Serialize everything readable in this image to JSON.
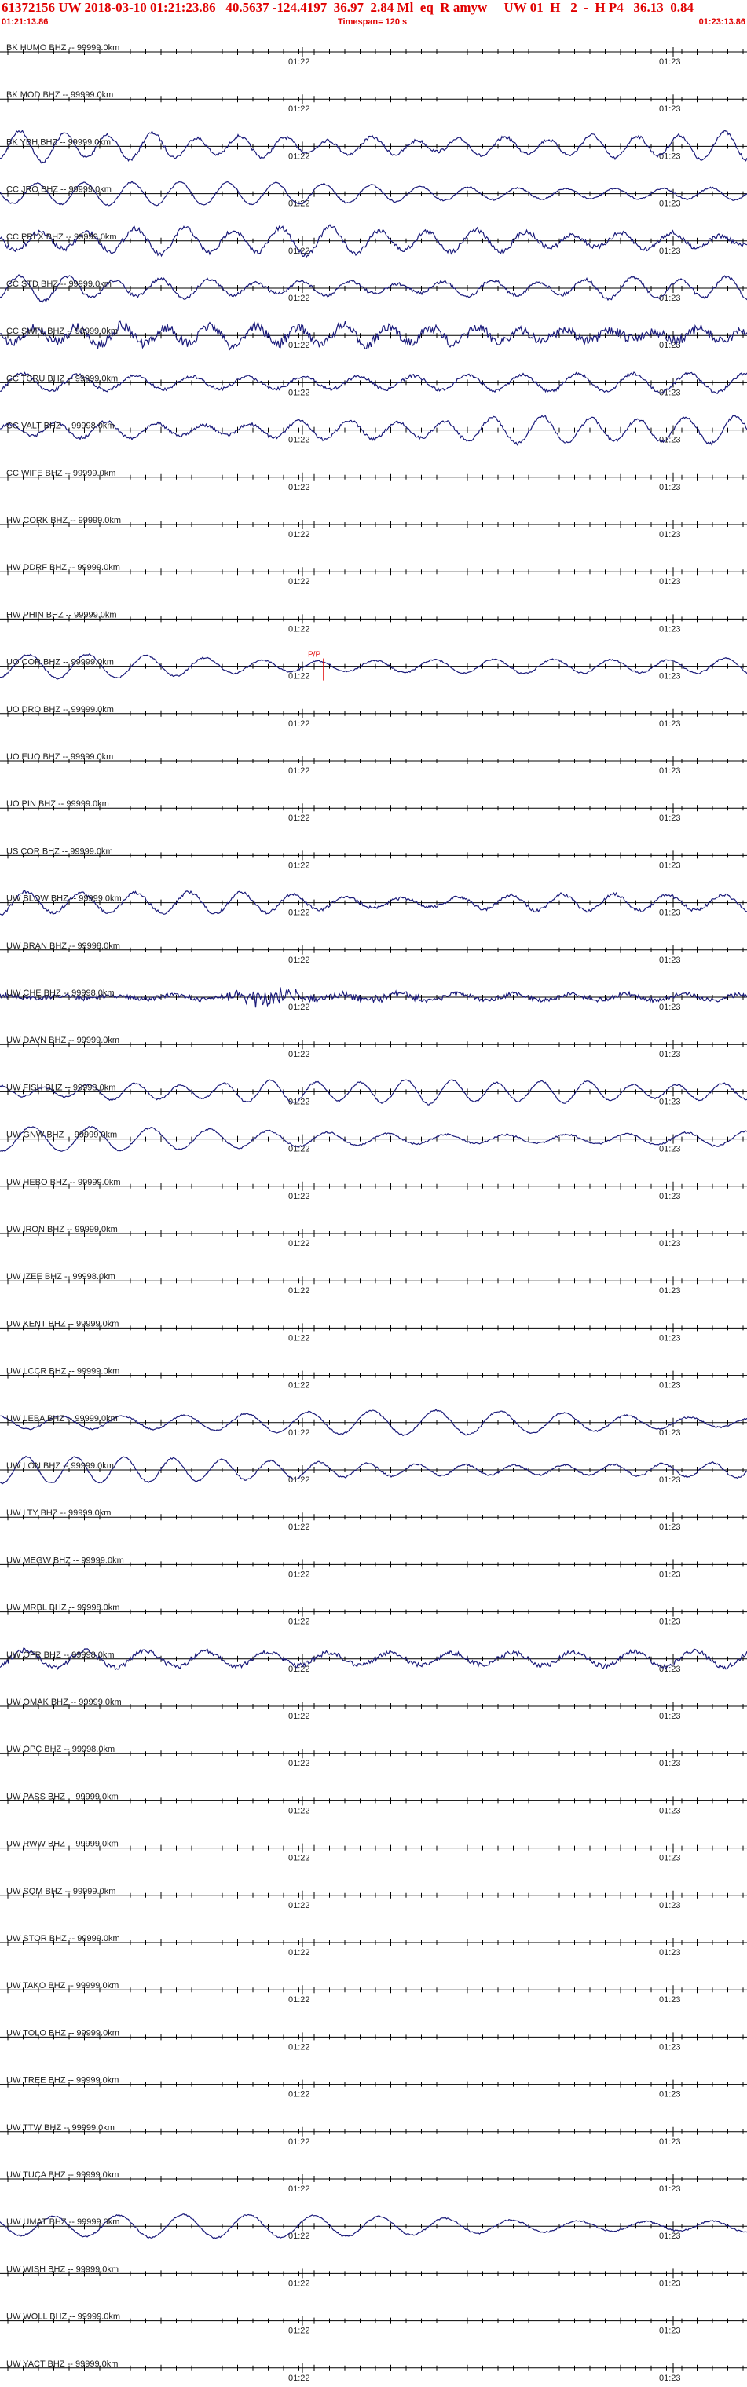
{
  "header": {
    "line1": "61372156 UW 2018-03-10 01:21:23.86   40.5637 -124.4197  36.97  2.84 Ml  eq  R amyw     UW 01  H   2  -  H P4   36.13  0.84",
    "start_time": "01:21:13.86",
    "timespan": "Timespan= 120 s",
    "end_time": "01:23:13.86"
  },
  "time_marks": [
    "01:22",
    "01:23"
  ],
  "pick": {
    "label": "P/P",
    "station": "UO COR BHZ",
    "color": "#e00000"
  },
  "trace_color": "#1a1a7a",
  "channels": [
    {
      "label": "BK HUMO BHZ -- 99999.0km",
      "active": false,
      "amp": 0
    },
    {
      "label": "BK MOD BHZ -- 99999.0km",
      "active": false,
      "amp": 0
    },
    {
      "label": "BK YBH BHZ -- 99999.0km",
      "active": true,
      "amp": 18,
      "noise": 2
    },
    {
      "label": "CC JRO BHZ -- 99999.0km",
      "active": true,
      "amp": 14,
      "noise": 1
    },
    {
      "label": "CC PRLX BHZ -- 99999.0km",
      "active": true,
      "amp": 16,
      "noise": 3
    },
    {
      "label": "CC STD BHZ -- 99999.0km",
      "active": true,
      "amp": 15,
      "noise": 2
    },
    {
      "label": "CC SWFL BHZ -- 99999.0km",
      "active": true,
      "amp": 12,
      "noise": 6
    },
    {
      "label": "CC TCRU BHZ -- 99999.0km",
      "active": true,
      "amp": 14,
      "noise": 2
    },
    {
      "label": "CC VALT BHZ -- 99998.0km",
      "active": true,
      "amp": 16,
      "noise": 2
    },
    {
      "label": "CC WIFE BHZ -- 99999.0km",
      "active": false,
      "amp": 0
    },
    {
      "label": "HW CORK BHZ -- 99999.0km",
      "active": false,
      "amp": 0
    },
    {
      "label": "HW DDRF BHZ -- 99999.0km",
      "active": false,
      "amp": 0
    },
    {
      "label": "HW PHIN BHZ -- 99999.0km",
      "active": false,
      "amp": 0
    },
    {
      "label": "UO COR BHZ -- 99999.0km",
      "active": true,
      "amp": 14,
      "noise": 1
    },
    {
      "label": "UO DRO BHZ -- 99999.0km",
      "active": false,
      "amp": 0
    },
    {
      "label": "UO EUO BHZ -- 99999.0km",
      "active": false,
      "amp": 0
    },
    {
      "label": "UO PIN BHZ -- 99999.0km",
      "active": false,
      "amp": 0
    },
    {
      "label": "US COR BHZ -- 99999.0km",
      "active": false,
      "amp": 0
    },
    {
      "label": "UW BLOW BHZ -- 99999.0km",
      "active": true,
      "amp": 15,
      "noise": 2
    },
    {
      "label": "UW BRAN BHZ -- 99998.0km",
      "active": false,
      "amp": 0
    },
    {
      "label": "UW CHE BHZ -- 99998.0km",
      "active": true,
      "amp": 4,
      "noise": 3,
      "burst": true
    },
    {
      "label": "UW DAVN BHZ -- 99999.0km",
      "active": false,
      "amp": 0
    },
    {
      "label": "UW FISH BHZ -- 99998.0km",
      "active": true,
      "amp": 14,
      "noise": 1
    },
    {
      "label": "UW GNW BHZ -- 99999.0km",
      "active": true,
      "amp": 15,
      "noise": 1
    },
    {
      "label": "UW HEBO BHZ -- 99999.0km",
      "active": false,
      "amp": 0
    },
    {
      "label": "UW IRON BHZ -- 99999.0km",
      "active": false,
      "amp": 0
    },
    {
      "label": "UW IZEE BHZ -- 99998.0km",
      "active": false,
      "amp": 0
    },
    {
      "label": "UW KENT BHZ -- 99999.0km",
      "active": false,
      "amp": 0
    },
    {
      "label": "UW LCCR BHZ -- 99999.0km",
      "active": false,
      "amp": 0
    },
    {
      "label": "UW LEBA BHZ -- 99999.0km",
      "active": true,
      "amp": 14,
      "noise": 1
    },
    {
      "label": "UW LON BHZ -- 99999.0km",
      "active": true,
      "amp": 16,
      "noise": 1
    },
    {
      "label": "UW LTY BHZ -- 99999.0km",
      "active": false,
      "amp": 0
    },
    {
      "label": "UW MEGW BHZ -- 99999.0km",
      "active": false,
      "amp": 0
    },
    {
      "label": "UW MRBL BHZ -- 99998.0km",
      "active": false,
      "amp": 0
    },
    {
      "label": "UW OFR BHZ -- 99998.0km",
      "active": true,
      "amp": 12,
      "noise": 3
    },
    {
      "label": "UW OMAK BHZ -- 99999.0km",
      "active": false,
      "amp": 0
    },
    {
      "label": "UW OPC BHZ -- 99998.0km",
      "active": false,
      "amp": 0
    },
    {
      "label": "UW PASS BHZ -- 99999.0km",
      "active": false,
      "amp": 0
    },
    {
      "label": "UW RWW BHZ -- 99999.0km",
      "active": false,
      "amp": 0
    },
    {
      "label": "UW SQM BHZ -- 99999.0km",
      "active": false,
      "amp": 0
    },
    {
      "label": "UW STOR BHZ -- 99999.0km",
      "active": false,
      "amp": 0
    },
    {
      "label": "UW TAKO BHZ -- 99999.0km",
      "active": false,
      "amp": 0
    },
    {
      "label": "UW TOLO BHZ -- 99999.0km",
      "active": false,
      "amp": 0
    },
    {
      "label": "UW TREE BHZ -- 99999.0km",
      "active": false,
      "amp": 0
    },
    {
      "label": "UW TTW BHZ -- 99999.0km",
      "active": false,
      "amp": 0
    },
    {
      "label": "UW TUCA BHZ -- 99999.0km",
      "active": false,
      "amp": 0
    },
    {
      "label": "UW UMAT BHZ -- 99999.0km",
      "active": true,
      "amp": 14,
      "noise": 1
    },
    {
      "label": "UW WISH BHZ -- 99999.0km",
      "active": false,
      "amp": 0
    },
    {
      "label": "UW WOLL BHZ -- 99999.0km",
      "active": false,
      "amp": 0
    },
    {
      "label": "UW YACT BHZ -- 99999.0km",
      "active": false,
      "amp": 0
    }
  ]
}
